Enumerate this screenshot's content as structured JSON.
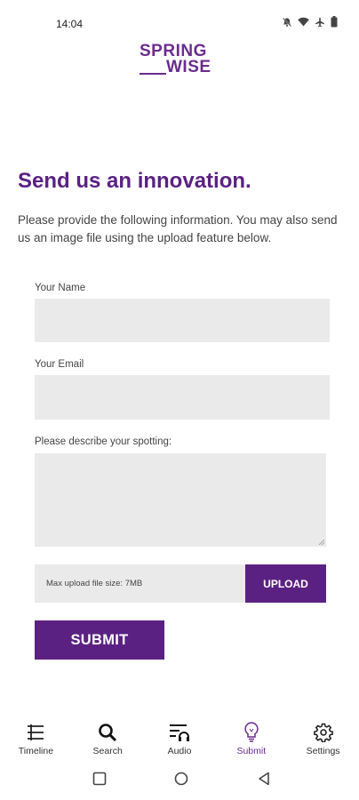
{
  "status_bar": {
    "time": "14:04"
  },
  "logo": {
    "line1": "SPRING",
    "line2": "WISE"
  },
  "page": {
    "heading": "Send us an innovation.",
    "intro": "Please provide the following information. You may also send us an image file using the upload feature below."
  },
  "form": {
    "name_label": "Your Name",
    "name_value": "",
    "email_label": "Your Email",
    "email_value": "",
    "description_label": "Please describe your spotting:",
    "description_value": "",
    "upload_hint": "Max upload file size: 7MB",
    "upload_label": "UPLOAD",
    "submit_label": "SUBMIT"
  },
  "tabs": [
    {
      "label": "Timeline",
      "icon": "timeline-icon"
    },
    {
      "label": "Search",
      "icon": "search-icon"
    },
    {
      "label": "Audio",
      "icon": "audio-icon"
    },
    {
      "label": "Submit",
      "icon": "lightbulb-icon",
      "active": true
    },
    {
      "label": "Settings",
      "icon": "gear-icon"
    }
  ],
  "colors": {
    "brand": "#5b2182",
    "field_bg": "#eaeaea"
  }
}
